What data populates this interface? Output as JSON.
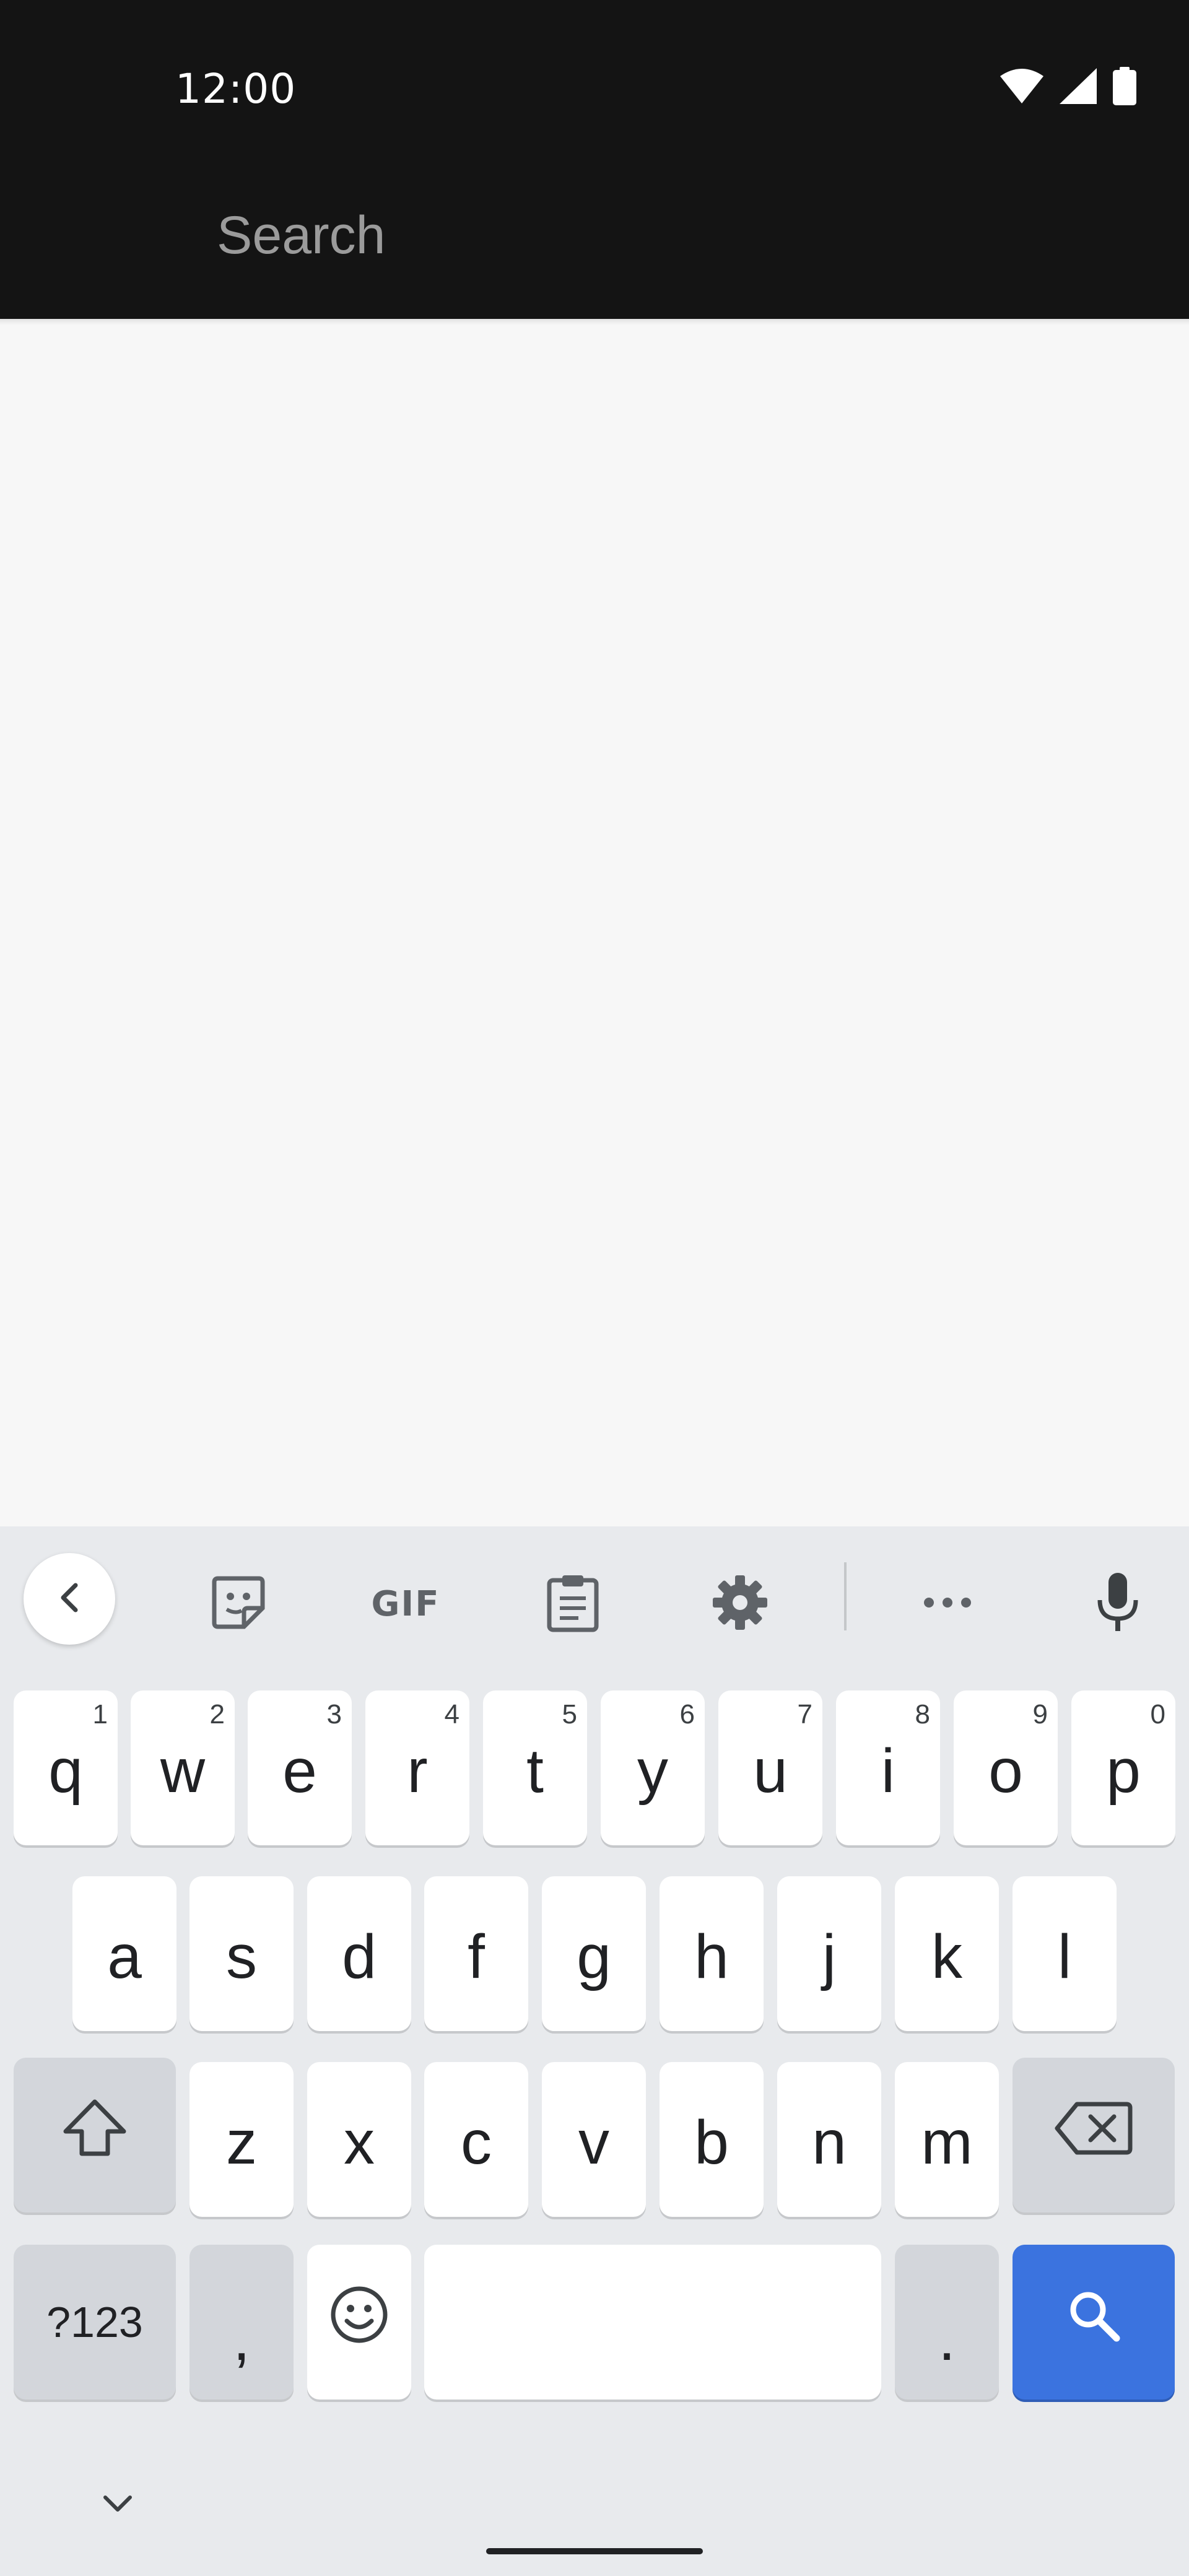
{
  "status_bar": {
    "time": "12:00",
    "icons": [
      "wifi-icon",
      "cellular-signal-icon",
      "battery-icon"
    ]
  },
  "app_bar": {
    "search_placeholder": "Search"
  },
  "keyboard": {
    "toolbar": {
      "items": [
        "back-chevron-icon",
        "sticker-icon",
        "gif",
        "clipboard-icon",
        "gear-icon",
        "more-icon",
        "microphone-icon"
      ],
      "gif_label": "GIF"
    },
    "row1": [
      {
        "key": "q",
        "hint": "1"
      },
      {
        "key": "w",
        "hint": "2"
      },
      {
        "key": "e",
        "hint": "3"
      },
      {
        "key": "r",
        "hint": "4"
      },
      {
        "key": "t",
        "hint": "5"
      },
      {
        "key": "y",
        "hint": "6"
      },
      {
        "key": "u",
        "hint": "7"
      },
      {
        "key": "i",
        "hint": "8"
      },
      {
        "key": "o",
        "hint": "9"
      },
      {
        "key": "p",
        "hint": "0"
      }
    ],
    "row2": [
      "a",
      "s",
      "d",
      "f",
      "g",
      "h",
      "j",
      "k",
      "l"
    ],
    "row3": [
      "z",
      "x",
      "c",
      "v",
      "b",
      "n",
      "m"
    ],
    "row4": {
      "symbols_label": "?123",
      "comma": ",",
      "period": "."
    }
  },
  "colors": {
    "app_bar": "#141414",
    "content_bg": "#f7f7f7",
    "keyboard_bg": "#e8eaed",
    "search_key": "#3b73df"
  }
}
